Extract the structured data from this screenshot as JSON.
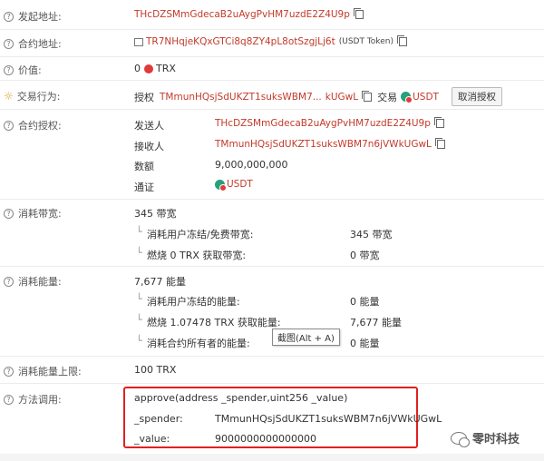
{
  "fields": {
    "sender": {
      "label": "发起地址",
      "value": "THcDZSMmGdecaB2uAygPvHM7uzdE2Z4U9p"
    },
    "contract": {
      "label": "合约地址",
      "value": "TR7NHqjeKQxGTCi8q8ZY4pL8otSzgjLj6t",
      "note": "(USDT Token)"
    },
    "price": {
      "label": "价值",
      "amount": "0",
      "unit": "TRX"
    },
    "action": {
      "label": "交易行为",
      "prefix": "授权",
      "address": "TMmunHQsjSdUKZT1suksWBM7...",
      "address_tail": "kUGwL",
      "trade": "交易",
      "token": "USDT",
      "cancel_button": "取消授权"
    },
    "approve": {
      "label": "合约授权",
      "rows": [
        {
          "key": "发送人",
          "value": "THcDZSMmGdecaB2uAygPvHM7uzdE2Z4U9p"
        },
        {
          "key": "接收人",
          "value": "TMmunHQsjSdUKZT1suksWBM7n6jVWkUGwL"
        },
        {
          "key": "数额",
          "value": "9,000,000,000"
        },
        {
          "key": "通证",
          "value": "USDT"
        }
      ]
    },
    "bandwidth": {
      "label": "消耗带宽",
      "total": "345 带宽",
      "items": [
        {
          "text": "消耗用户冻结/免费带宽:",
          "value": "345 带宽"
        },
        {
          "text": "燃烧 0 TRX 获取带宽:",
          "value": "0 带宽"
        }
      ]
    },
    "energy": {
      "label": "消耗能量",
      "total": "7,677 能量",
      "items": [
        {
          "text": "消耗用户冻结的能量:",
          "value": "0 能量"
        },
        {
          "text": "燃烧 1.07478 TRX 获取能量:",
          "value": "7,677 能量"
        },
        {
          "text": "消耗合约所有者的能量:",
          "value": "0 能量"
        }
      ]
    },
    "energy_limit": {
      "label": "消耗能量上限",
      "value": "100 TRX"
    },
    "method": {
      "label": "方法调用",
      "signature": "approve(address _spender,uint256 _value)",
      "params": [
        {
          "key": "_spender:",
          "value": "TMmunHQsjSdUKZT1suksWBM7n6jVWkUGwL"
        },
        {
          "key": "_value:",
          "value": "9000000000000000"
        }
      ]
    }
  },
  "tooltip": "截图(Alt + A)",
  "watermark": "零时科技",
  "colors": {
    "address": "#c23a2b",
    "highlight_box": "#e0201e",
    "usdt": "#26a17b"
  }
}
